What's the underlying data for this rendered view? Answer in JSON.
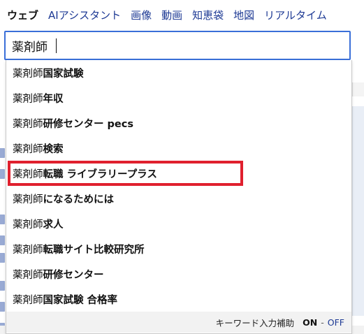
{
  "tabs": [
    {
      "label": "ウェブ",
      "active": true
    },
    {
      "label": "AIアシスタント"
    },
    {
      "label": "画像"
    },
    {
      "label": "動画"
    },
    {
      "label": "知恵袋"
    },
    {
      "label": "地図"
    },
    {
      "label": "リアルタイム"
    }
  ],
  "search": {
    "value": "薬剤師"
  },
  "suggestions": [
    {
      "query": "薬剤師",
      "rest": "国家試験"
    },
    {
      "query": "薬剤師",
      "rest": " 年収"
    },
    {
      "query": "薬剤師",
      "rest": "研修センター pecs"
    },
    {
      "query": "薬剤師",
      "rest": " 検索"
    },
    {
      "query": "薬剤師",
      "rest": " 転職 ライブラリープラス",
      "highlighted": true
    },
    {
      "query": "薬剤師",
      "rest": "になるためには"
    },
    {
      "query": "薬剤師",
      "rest": " 求人"
    },
    {
      "query": "薬剤師",
      "rest": " 転職サイト比較研究所"
    },
    {
      "query": "薬剤師",
      "rest": "研修センター"
    },
    {
      "query": "薬剤師",
      "rest": "国家試験 合格率"
    }
  ],
  "footer": {
    "label": "キーワード入力補助",
    "on": "ON",
    "separator": "-",
    "off": "OFF"
  },
  "colors": {
    "highlight_border": "#e0202e",
    "focus_border": "#3a6fd8",
    "link": "#1d3994"
  }
}
